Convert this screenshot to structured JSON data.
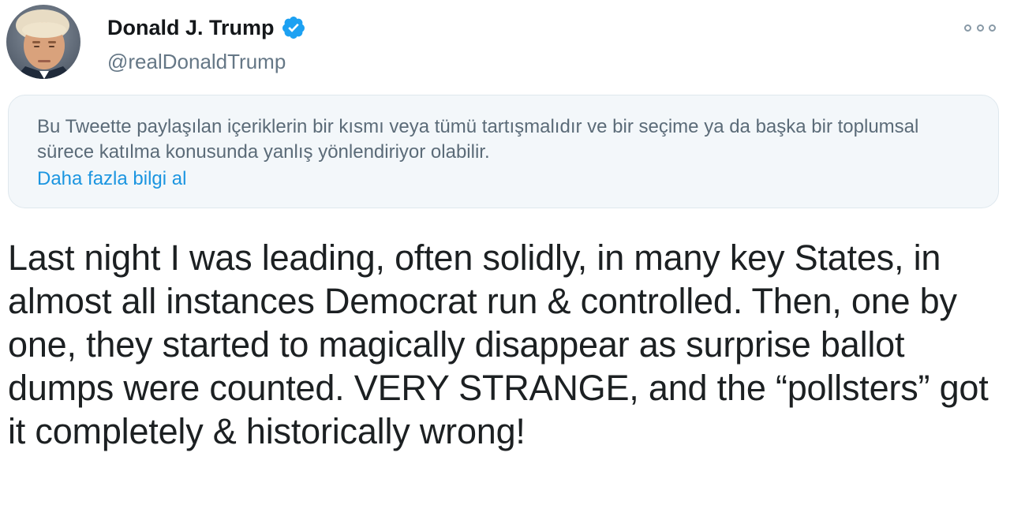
{
  "author": {
    "display_name": "Donald J. Trump",
    "handle": "@realDonaldTrump",
    "avatar_icon": "profile-photo",
    "verified_icon": "verified-badge-icon"
  },
  "menu": {
    "icon": "more-options-icon"
  },
  "warning": {
    "text": "Bu Tweette paylaşılan içeriklerin bir kısmı veya tümü tartışmalıdır ve bir seçime ya da başka bir toplumsal sürece katılma konusunda yanlış yönlendiriyor olabilir.",
    "link_label": "Daha fazla bilgi al",
    "link_color": "#1b95e0"
  },
  "tweet": {
    "text": "Last night I was leading, often solidly, in many key States, in almost all instances Democrat run & controlled. Then, one by one, they started to magically disappear as surprise ballot dumps were counted. VERY STRANGE, and the “pollsters” got it completely & historically wrong!"
  },
  "colors": {
    "verified_blue": "#1da1f2",
    "muted_text": "#657786"
  }
}
